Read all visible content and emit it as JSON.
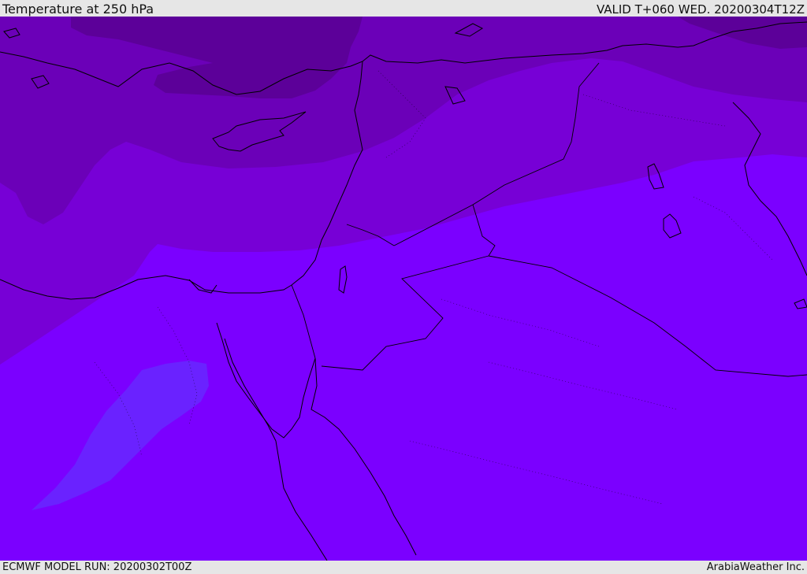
{
  "header": {
    "title": "Temperature at 250 hPa",
    "valid": "VALID T+060 WED. 20200304T12Z"
  },
  "footer": {
    "model_run": "ECMWF MODEL RUN: 20200302T00Z",
    "credit": "ArabiaWeather Inc."
  },
  "map": {
    "colors": {
      "band_coldest": "#5c0099",
      "band_cold": "#6b00b8",
      "band_mid": "#7700d6",
      "band_base": "#7b00ff",
      "band_warm": "#6a22ff",
      "coastline": "#000000"
    }
  }
}
